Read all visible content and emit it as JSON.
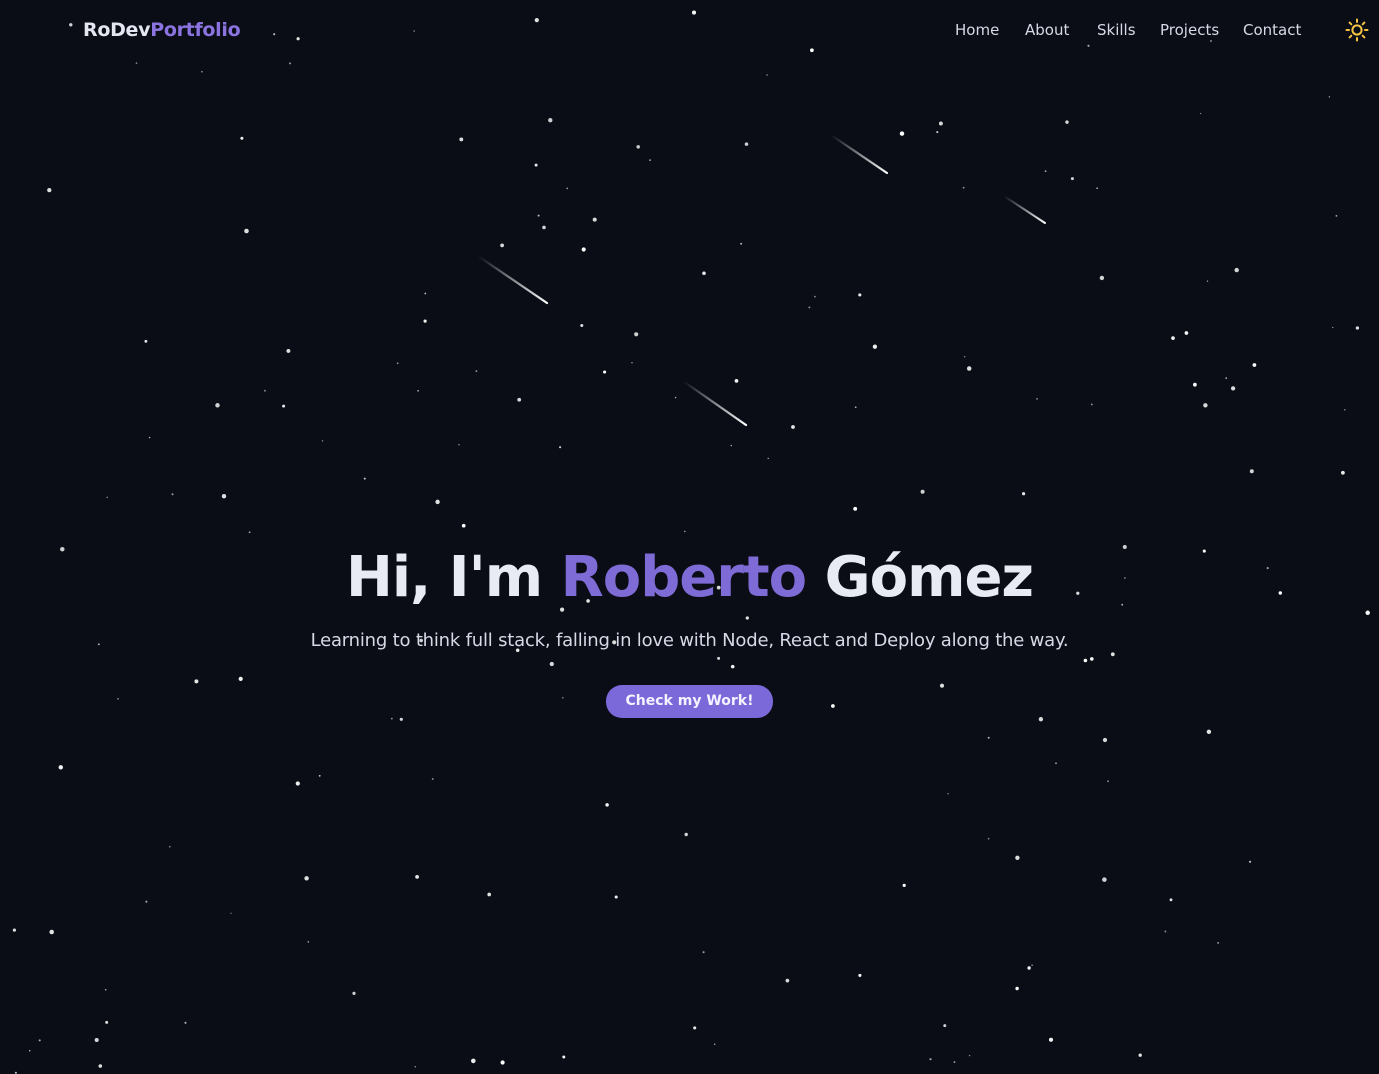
{
  "brand": {
    "part1": "RoDev",
    "part2": "Portfolio"
  },
  "nav": {
    "items": [
      {
        "label": "Home"
      },
      {
        "label": "About"
      },
      {
        "label": "Skills"
      },
      {
        "label": "Projects"
      },
      {
        "label": "Contact"
      }
    ],
    "theme_toggle_icon": "sun-icon"
  },
  "hero": {
    "greeting": "Hi, I'm",
    "first_name": "Roberto",
    "last_name": "Gómez",
    "subtitle": "Learning to think full stack, falling in love with Node, React and Deploy along the way.",
    "cta_label": "Check my Work!"
  },
  "colors": {
    "background": "#0a0d16",
    "accent": "#7f6bd6",
    "button": "#7b68d9",
    "text": "#e8eaf4",
    "sun": "#f6c343"
  }
}
